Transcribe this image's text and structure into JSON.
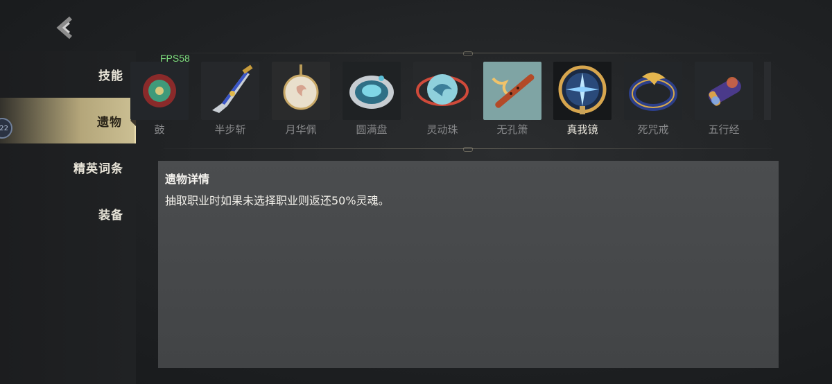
{
  "fps_label": "FPS58",
  "sidebar": {
    "items": [
      {
        "label": "技能"
      },
      {
        "label": "遗物"
      },
      {
        "label": "精英词条"
      },
      {
        "label": "装备"
      }
    ],
    "level_badge": "22"
  },
  "relics": [
    {
      "name": "鼓",
      "icon": "drum-relic-icon"
    },
    {
      "name": "半步斩",
      "icon": "blade-relic-icon"
    },
    {
      "name": "月华佩",
      "icon": "moon-pendant-relic-icon"
    },
    {
      "name": "圆满盘",
      "icon": "plate-relic-icon"
    },
    {
      "name": "灵动珠",
      "icon": "orb-relic-icon"
    },
    {
      "name": "无孔箫",
      "icon": "flute-relic-icon"
    },
    {
      "name": "真我镜",
      "icon": "mirror-relic-icon",
      "selected": true
    },
    {
      "name": "死咒戒",
      "icon": "ring-relic-icon"
    },
    {
      "name": "五行经",
      "icon": "scroll-relic-icon"
    }
  ],
  "detail": {
    "title": "遗物详情",
    "description": "抽取职业时如果未选择职业则返还50%灵魂。"
  },
  "colors": {
    "sidebar_active": "#cbbf93",
    "fps_text": "#7fe07f",
    "panel_bg": "#4b4d4f"
  }
}
